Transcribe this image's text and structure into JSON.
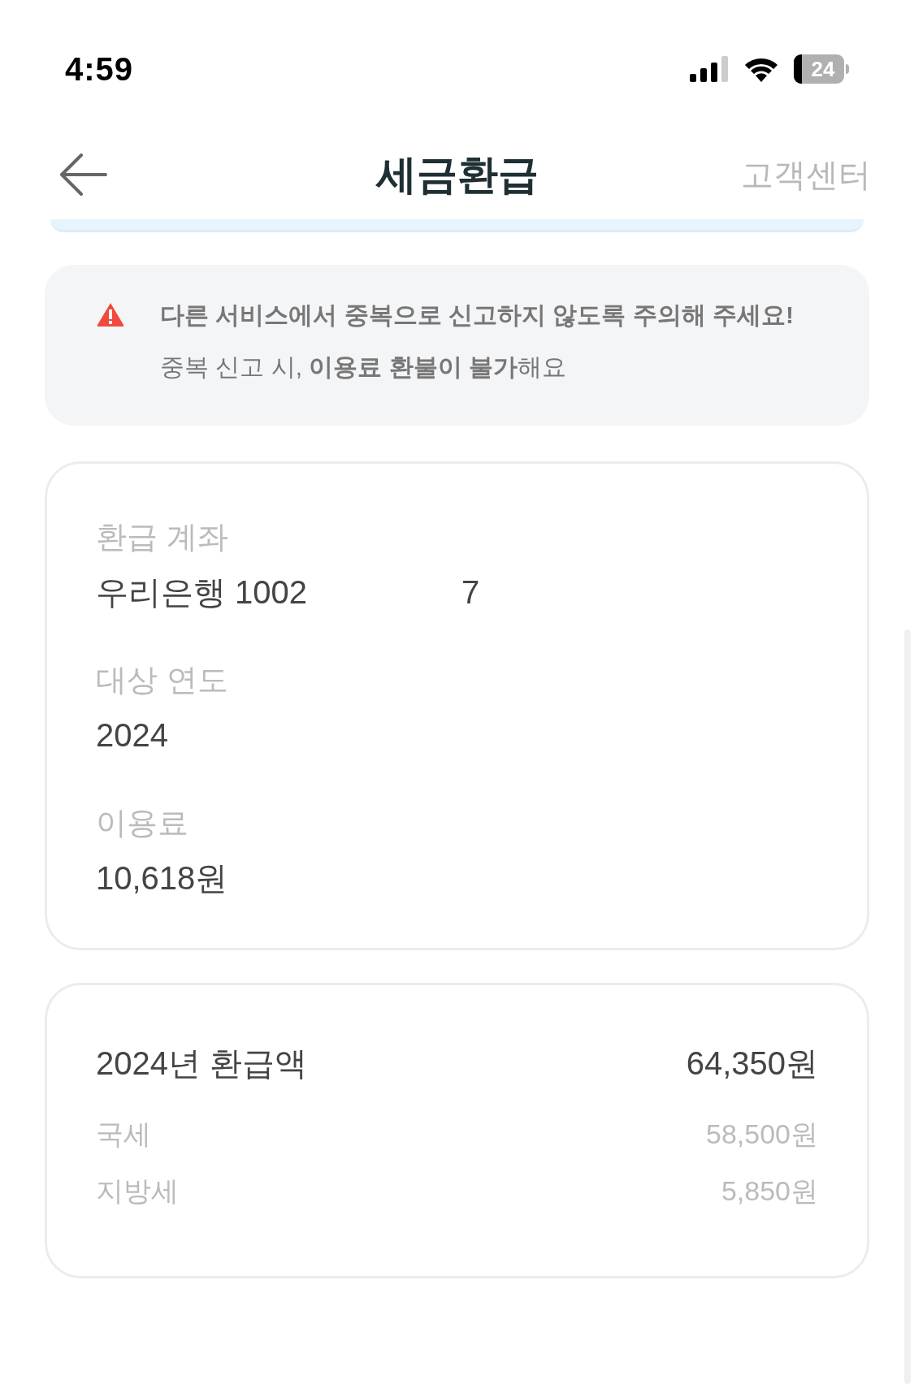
{
  "status_bar": {
    "time": "4:59",
    "battery": "24"
  },
  "header": {
    "title": "세금환급",
    "action": "고객센터"
  },
  "notice": {
    "text": "**다른 서비스에서 중복으로 신고하지 않도록 주의해 주세요!** 중복 신고 시, **이용료 환불이 불가**해요"
  },
  "details": [
    {
      "label": "환급 계좌",
      "values": [
        "우리은행 1002",
        "7"
      ]
    },
    {
      "label": "대상 연도",
      "values": [
        "2024"
      ]
    },
    {
      "label": "이용료",
      "values": [
        "10,618원"
      ]
    }
  ],
  "refund": {
    "title": "2024년 환급액",
    "total": "64,350원",
    "items": [
      {
        "label": "국세",
        "amount": "58,500원"
      },
      {
        "label": "지방세",
        "amount": "5,850원"
      }
    ]
  }
}
